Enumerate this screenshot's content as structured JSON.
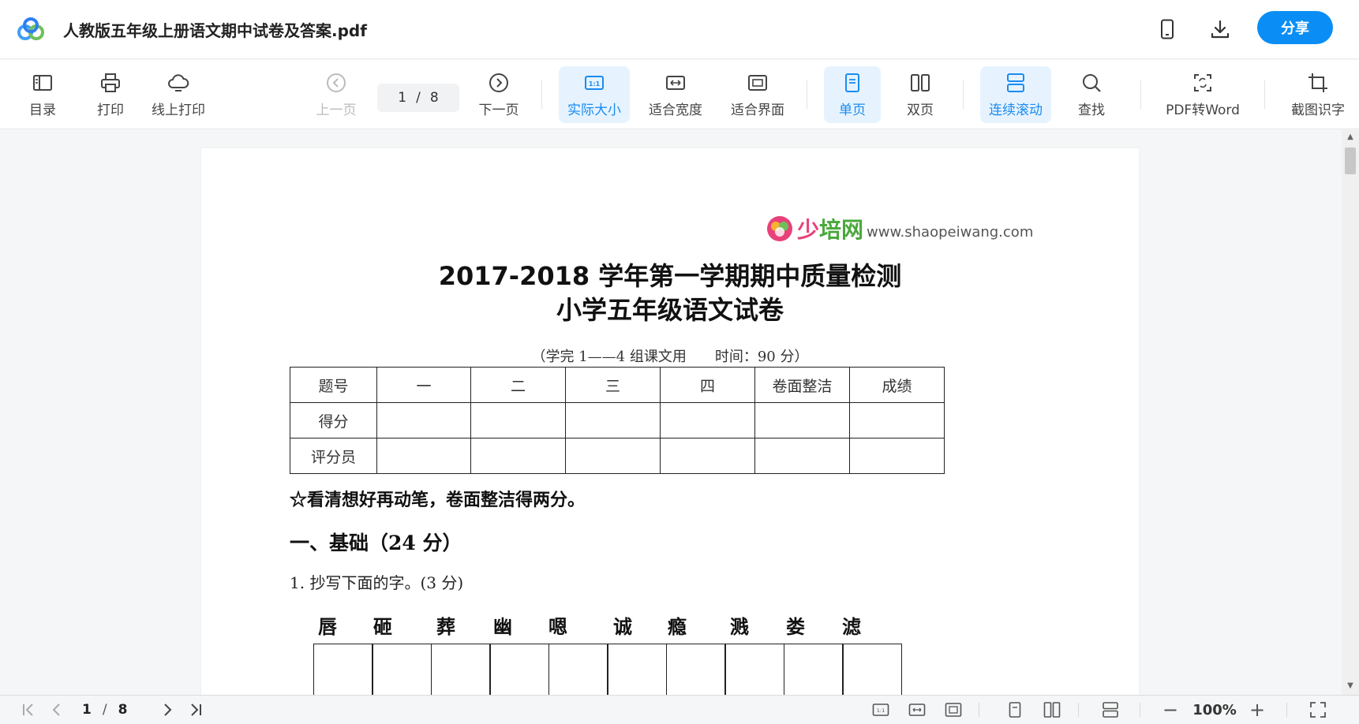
{
  "window": {
    "title": "人教版五年级上册语文期中试卷及答案.pdf",
    "share_label": "分享"
  },
  "toolbar": {
    "toc": "目录",
    "print": "打印",
    "online_print": "线上打印",
    "prev": "上一页",
    "next": "下一页",
    "current_page": "1",
    "page_sep": "/",
    "total_pages": "8",
    "actual_size": "实际大小",
    "fit_width": "适合宽度",
    "fit_window": "适合界面",
    "single_page": "单页",
    "double_page": "双页",
    "continuous": "连续滚动",
    "find": "查找",
    "pdf_to_word": "PDF转Word",
    "ocr": "截图识字",
    "actual_size_icon_text": "1:1"
  },
  "document": {
    "brand_cn_1": "少",
    "brand_cn_2": "培网",
    "brand_url": "www.shaopeiwang.com",
    "title_line1": "2017-2018 学年第一学期期中质量检测",
    "title_line2": "小学五年级语文试卷",
    "subtitle": "（学完 1——4 组课文用　　时间：90 分）",
    "score_table": {
      "headers": [
        "题号",
        "一",
        "二",
        "三",
        "四",
        "卷面整洁",
        "成绩"
      ],
      "rows": [
        [
          "得分"
        ],
        [
          "评分员"
        ]
      ]
    },
    "note": "☆看清想好再动笔，卷面整洁得两分。",
    "section1": "一、基础（24 分）",
    "q1": "1. 抄写下面的字。(3 分)",
    "chars": [
      "唇",
      "砸",
      "葬",
      "幽",
      "嗯",
      "诚",
      "瘾",
      "溅",
      "娄",
      "滤"
    ]
  },
  "statusbar": {
    "current_page": "1",
    "page_sep": "/",
    "total_pages": "8",
    "zoom": "100%",
    "zoom_minus": "−",
    "zoom_plus": "+"
  },
  "colors": {
    "accent": "#0a8ef5",
    "active_bg": "#e6f3ff",
    "active_text": "#1a8cf0"
  }
}
